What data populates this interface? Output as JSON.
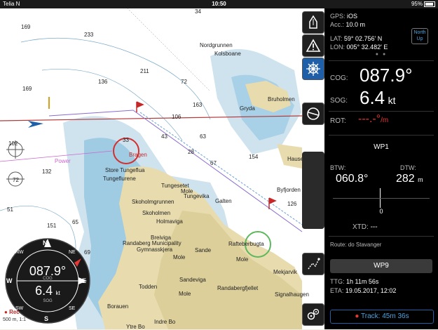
{
  "status_bar": {
    "carrier": "Telia N",
    "time": "10:50",
    "battery": "95%"
  },
  "panel": {
    "gps_label": "GPS:",
    "gps_value": "iOS",
    "acc_label": "Acc.:",
    "acc_value": "10.0 m",
    "lat_label": "LAT:",
    "lat_value": "59° 02.756' N",
    "lon_label": "LON:",
    "lon_value": "005° 32.482' E",
    "north_up": "North Up",
    "cog_label": "COG:",
    "cog_value": "087.9°",
    "sog_label": "SOG:",
    "sog_value": "6.4",
    "sog_unit": "kt",
    "rot_label": "ROT:",
    "rot_value": "---.-°",
    "rot_unit": "/m",
    "wp_title": "WP1",
    "btw_label": "BTW:",
    "btw_value": "060.8°",
    "dtw_label": "DTW:",
    "dtw_value": "282",
    "dtw_unit": "m",
    "xte_zero": "0",
    "xtd_label": "XTD:",
    "xtd_value": "---",
    "route_label": "Route: do Stavanger",
    "next_wp": "WP9",
    "ttg_label": "TTG:",
    "ttg_value": "1h 11m 56s",
    "eta_label": "ETA:",
    "eta_value": "19.05.2017, 12:02",
    "track_label": "Track: 45m 36s"
  },
  "compass": {
    "cog_value": "087.9°",
    "cog_label": "COG",
    "sog_value": "6.4",
    "sog_unit": "kt",
    "sog_label": "SOG",
    "n": "N",
    "s": "S",
    "e": "E",
    "w": "W",
    "ne": "NE",
    "nw": "NW",
    "se": "SE",
    "sw": "SW"
  },
  "scale_label": "500 m, 1:1",
  "rec_label": "Rec",
  "map_labels": {
    "nordgrunnen": "Nordgrunnen",
    "kolsboane": "Kolsboane",
    "bruholmen": "Bruholmen",
    "gryda": "Gryda",
    "hausen": "Hausen",
    "byfjorden": "Byfjorden",
    "bragen": "Bragen",
    "store_tungeflua": "Store Tungeflua",
    "tungeflurene": "Tungeflurene",
    "tungesetet": "Tungesetet",
    "mole1": "Mole",
    "tungevika": "Tungevika",
    "skoholmgrunnen": "Skoholmgrunnen",
    "galten": "Galten",
    "skoholmen": "Skoholmen",
    "holmaviga": "Holmaviga",
    "breiviga": "Breiviga",
    "randaberg_mun": "Randaberg Municipality",
    "gymnasskjera": "Gymnasskjera",
    "sande": "Sande",
    "mole2": "Mole",
    "sandeviga": "Sandeviga",
    "raftebergbugta": "Rafteberbugta",
    "mole3": "Mole",
    "mekjarvik": "Mekjarvik",
    "randabergfjellet": "Randabergfjellet",
    "todden": "Todden",
    "mole4": "Mole",
    "borauen": "Borauen",
    "signalhaugen": "Signalhaugen",
    "indre_bo": "Indre Bo",
    "ytre_bo": "Ytre Bo",
    "power": "Power",
    "d169": "169",
    "d233": "233",
    "d169b": "169",
    "d136": "136",
    "d211": "211",
    "d72": "72",
    "d163": "163",
    "d132": "132",
    "d102": "102",
    "d72b": "72",
    "d51": "51",
    "d65": "65",
    "d151": "151",
    "d69": "69",
    "d154": "154",
    "d126": "126",
    "d33": "33",
    "d106": "106",
    "d34": "34",
    "d43": "43",
    "d63": "63",
    "d67": "67",
    "d28": "28"
  }
}
